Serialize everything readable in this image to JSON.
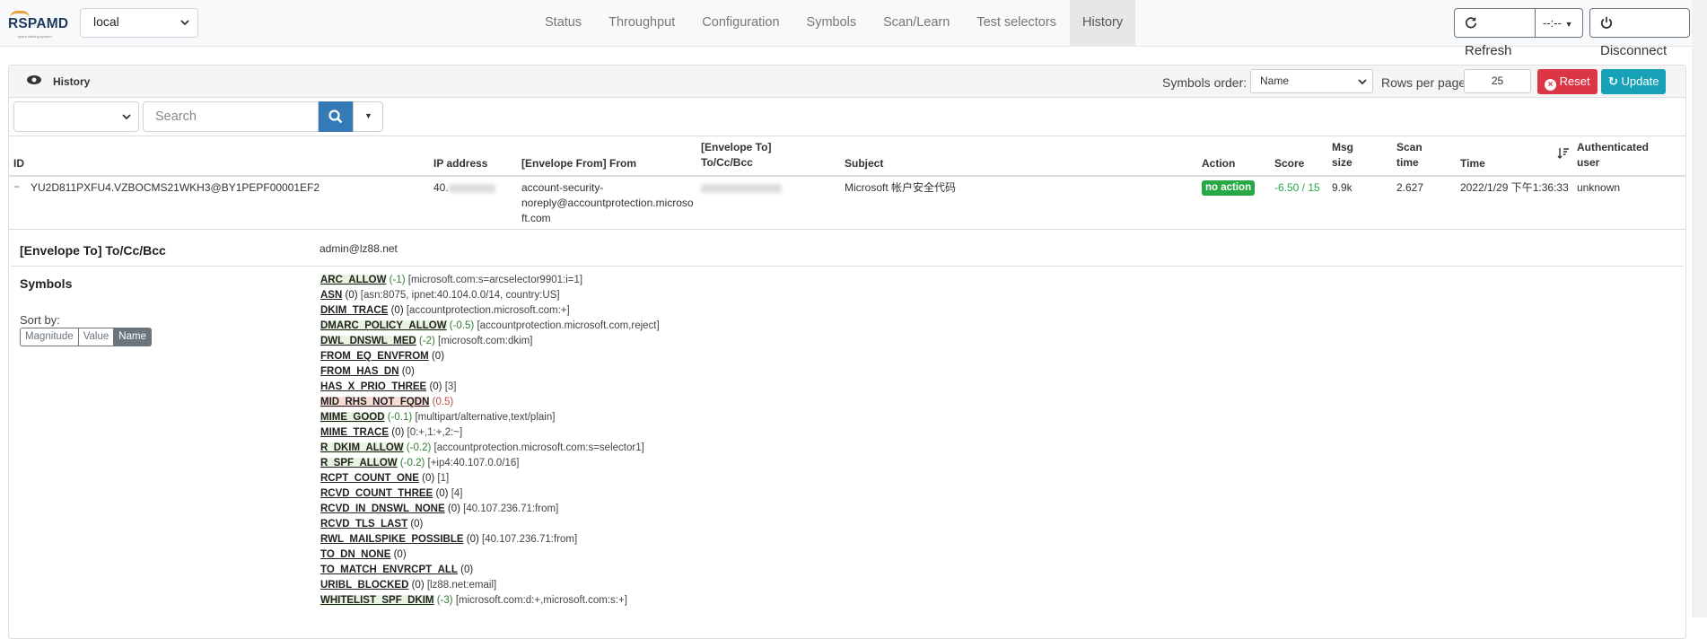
{
  "brand": {
    "logo_text": "RSPAMD",
    "logo_sub": "spam filtering system"
  },
  "host_select": {
    "value": "local"
  },
  "nav": [
    {
      "label": "Status",
      "active": false
    },
    {
      "label": "Throughput",
      "active": false
    },
    {
      "label": "Configuration",
      "active": false
    },
    {
      "label": "Symbols",
      "active": false
    },
    {
      "label": "Scan/Learn",
      "active": false
    },
    {
      "label": "Test selectors",
      "active": false
    },
    {
      "label": "History",
      "active": true
    }
  ],
  "toolbar": {
    "refresh": "Refresh",
    "interval": "--:--",
    "disconnect": "Disconnect"
  },
  "card": {
    "title": "History",
    "symbols_order_label": "Symbols order:",
    "symbols_order_value": "Name",
    "rows_per_page_label": "Rows per page:",
    "rows_per_page_value": "25",
    "reset": "Reset",
    "update": "Update"
  },
  "search": {
    "placeholder": "Search"
  },
  "table": {
    "headers": {
      "id": "ID",
      "ip": "IP address",
      "from": "[Envelope From] From",
      "to_line1": "[Envelope To]",
      "to_line2": "To/Cc/Bcc",
      "subject": "Subject",
      "action": "Action",
      "score": "Score",
      "size_l1": "Msg",
      "size_l2": "size",
      "scan_l1": "Scan",
      "scan_l2": "time",
      "time": "Time",
      "auth_l1": "Authenticated",
      "auth_l2": "user"
    },
    "row": {
      "toggle": "−",
      "id": "YU2D811PXFU4.VZBOCMS21WKH3@BY1PEPF00001EF2",
      "ip": "40.",
      "from_l1": "account-security-",
      "from_l2": "noreply@accountprotection.microso",
      "from_l3": "ft.com",
      "subject": "Microsoft 帐户安全代码",
      "action": "no action",
      "score": "-6.50 / 15",
      "size": "9.9k",
      "scan_time": "2.627",
      "time": "2022/1/29 下午1:36:33",
      "user": "unknown"
    }
  },
  "details": {
    "to_label": "[Envelope To] To/Cc/Bcc",
    "to_value": "admin@lz88.net",
    "symbols_label": "Symbols",
    "sort_by_label": "Sort by:",
    "sort_options": [
      "Magnitude",
      "Value",
      "Name"
    ],
    "sort_active": "Name",
    "symbols": [
      {
        "name": "ARC_ALLOW",
        "score": "(-1)",
        "opts": "[microsoft.com:s=arcselector9901:i=1]",
        "kind": "neg"
      },
      {
        "name": "ASN",
        "score": "(0)",
        "opts": "[asn:8075, ipnet:40.104.0.0/14, country:US]",
        "kind": "zero"
      },
      {
        "name": "DKIM_TRACE",
        "score": "(0)",
        "opts": "[accountprotection.microsoft.com:+]",
        "kind": "zero"
      },
      {
        "name": "DMARC_POLICY_ALLOW",
        "score": "(-0.5)",
        "opts": "[accountprotection.microsoft.com,reject]",
        "kind": "neg"
      },
      {
        "name": "DWL_DNSWL_MED",
        "score": "(-2)",
        "opts": "[microsoft.com:dkim]",
        "kind": "neg"
      },
      {
        "name": "FROM_EQ_ENVFROM",
        "score": "(0)",
        "opts": "",
        "kind": "zero"
      },
      {
        "name": "FROM_HAS_DN",
        "score": "(0)",
        "opts": "",
        "kind": "zero"
      },
      {
        "name": "HAS_X_PRIO_THREE",
        "score": "(0)",
        "opts": "[3]",
        "kind": "zero"
      },
      {
        "name": "MID_RHS_NOT_FQDN",
        "score": "(0.5)",
        "opts": "",
        "kind": "pos"
      },
      {
        "name": "MIME_GOOD",
        "score": "(-0.1)",
        "opts": "[multipart/alternative,text/plain]",
        "kind": "neg"
      },
      {
        "name": "MIME_TRACE",
        "score": "(0)",
        "opts": "[0:+,1:+,2:~]",
        "kind": "zero"
      },
      {
        "name": "R_DKIM_ALLOW",
        "score": "(-0.2)",
        "opts": "[accountprotection.microsoft.com:s=selector1]",
        "kind": "neg"
      },
      {
        "name": "R_SPF_ALLOW",
        "score": "(-0.2)",
        "opts": "[+ip4:40.107.0.0/16]",
        "kind": "neg"
      },
      {
        "name": "RCPT_COUNT_ONE",
        "score": "(0)",
        "opts": "[1]",
        "kind": "zero"
      },
      {
        "name": "RCVD_COUNT_THREE",
        "score": "(0)",
        "opts": "[4]",
        "kind": "zero"
      },
      {
        "name": "RCVD_IN_DNSWL_NONE",
        "score": "(0)",
        "opts": "[40.107.236.71:from]",
        "kind": "zero"
      },
      {
        "name": "RCVD_TLS_LAST",
        "score": "(0)",
        "opts": "",
        "kind": "zero"
      },
      {
        "name": "RWL_MAILSPIKE_POSSIBLE",
        "score": "(0)",
        "opts": "[40.107.236.71:from]",
        "kind": "zero"
      },
      {
        "name": "TO_DN_NONE",
        "score": "(0)",
        "opts": "",
        "kind": "zero"
      },
      {
        "name": "TO_MATCH_ENVRCPT_ALL",
        "score": "(0)",
        "opts": "",
        "kind": "zero"
      },
      {
        "name": "URIBL_BLOCKED",
        "score": "(0)",
        "opts": "[lz88.net:email]",
        "kind": "zero"
      },
      {
        "name": "WHITELIST_SPF_DKIM",
        "score": "(-3)",
        "opts": "[microsoft.com:d:+,microsoft.com:s:+]",
        "kind": "neg"
      }
    ]
  },
  "colors": {
    "primary": "#337ab7",
    "danger": "#dc3545",
    "info": "#17a2b8",
    "success": "#28a745"
  }
}
